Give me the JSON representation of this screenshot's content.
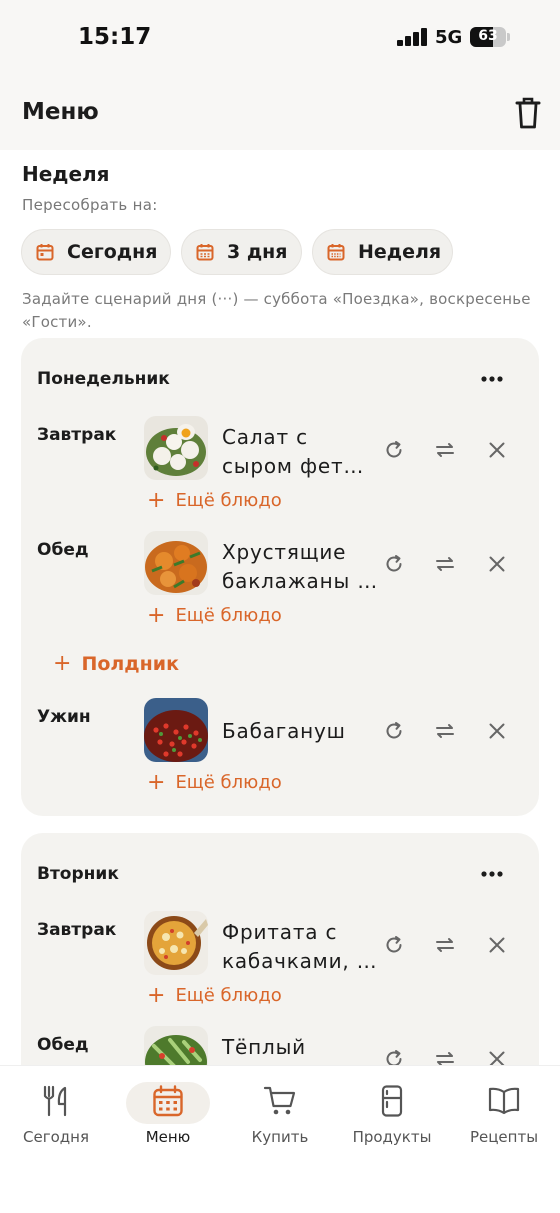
{
  "status_bar": {
    "time": "15:17",
    "network": "5G",
    "battery": "63",
    "battery_level": 0.63
  },
  "header": {
    "title": "Меню"
  },
  "rebuild": {
    "section_title": "Неделя",
    "label": "Пересобрать на:",
    "chips": [
      "Сегодня",
      "3 дня",
      "Неделя"
    ],
    "hint": "Задайте сценарий дня (···) — суббота «Поездка», воскресенье «Гости»."
  },
  "days": [
    {
      "name": "Понедельник",
      "meals": [
        {
          "label": "Завтрак",
          "dish": "Салат с сыром фет…",
          "add": "Ещё блюдо"
        },
        {
          "label": "Обед",
          "dish": "Хрустящие баклажаны …",
          "add": "Ещё блюдо"
        },
        {
          "label": "Ужин",
          "dish": "Бабагануш",
          "add": "Ещё блюдо"
        }
      ],
      "add_meal": "Полдник"
    },
    {
      "name": "Вторник",
      "meals": [
        {
          "label": "Завтрак",
          "dish": "Фритата с кабачками, …",
          "add": "Ещё блюдо"
        },
        {
          "label": "Обед",
          "dish": "Тёплый"
        }
      ]
    }
  ],
  "tabs": [
    {
      "label": "Сегодня",
      "icon": "fork-knife-icon"
    },
    {
      "label": "Меню",
      "icon": "calendar-icon",
      "active": true
    },
    {
      "label": "Купить",
      "icon": "cart-icon"
    },
    {
      "label": "Продукты",
      "icon": "fridge-icon"
    },
    {
      "label": "Рецепты",
      "icon": "book-icon"
    }
  ],
  "colors": {
    "accent": "#d9662a",
    "card": "#f4f3f0",
    "chip": "#f1f0ed"
  }
}
